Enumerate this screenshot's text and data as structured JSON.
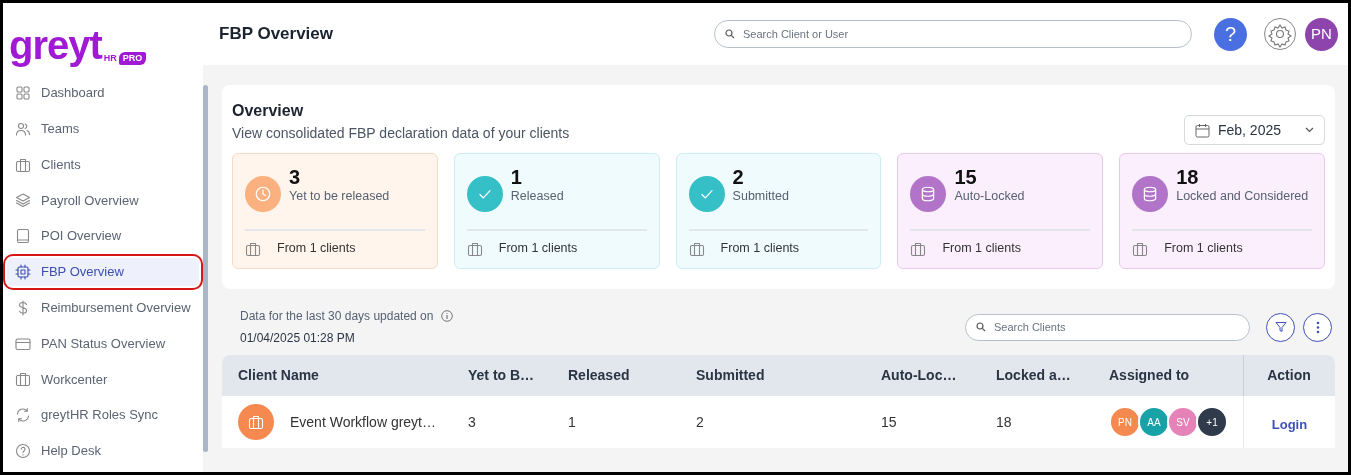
{
  "logo": {
    "word": "greyt",
    "sub": "HR",
    "badge": "PRO"
  },
  "sidebar": {
    "items": [
      {
        "label": "Dashboard",
        "kind": "grid",
        "selected": false,
        "highlighted": false
      },
      {
        "label": "Teams",
        "kind": "people",
        "selected": false,
        "highlighted": false
      },
      {
        "label": "Clients",
        "kind": "briefcase",
        "selected": false,
        "highlighted": false
      },
      {
        "label": "Payroll Overview",
        "kind": "layers",
        "selected": false,
        "highlighted": false
      },
      {
        "label": "POI Overview",
        "kind": "book",
        "selected": false,
        "highlighted": false
      },
      {
        "label": "FBP Overview",
        "kind": "chip",
        "selected": true,
        "highlighted": true
      },
      {
        "label": "Reimbursement Overview",
        "kind": "dollar",
        "selected": false,
        "highlighted": false
      },
      {
        "label": "PAN Status Overview",
        "kind": "card",
        "selected": false,
        "highlighted": false
      },
      {
        "label": "Workcenter",
        "kind": "briefcase",
        "selected": false,
        "highlighted": false
      },
      {
        "label": "greytHR Roles Sync",
        "kind": "sync",
        "selected": false,
        "highlighted": false
      },
      {
        "label": "Help Desk",
        "kind": "help",
        "selected": false,
        "highlighted": false
      }
    ]
  },
  "header": {
    "title": "FBP Overview",
    "search": {
      "placeholder": "Search Client or User"
    },
    "help": "?",
    "user_initials": "PN"
  },
  "overview": {
    "title": "Overview",
    "subtitle": "View consolidated FBP declaration data of your clients",
    "month": "Feb, 2025",
    "stats": [
      {
        "count": "3",
        "label": "Yet to be released",
        "footer": "From 1 clients",
        "kind": "pending"
      },
      {
        "count": "1",
        "label": "Released",
        "footer": "From 1 clients",
        "kind": "done"
      },
      {
        "count": "2",
        "label": "Submitted",
        "footer": "From 1 clients",
        "kind": "done"
      },
      {
        "count": "15",
        "label": "Auto-Locked",
        "footer": "From 1 clients",
        "kind": "locked"
      },
      {
        "count": "18",
        "label": "Locked and Considered",
        "footer": "From 1 clients",
        "kind": "locked"
      }
    ]
  },
  "data_note": {
    "text": "Data for the last 30 days updated on",
    "updated": "01/04/2025 01:28 PM"
  },
  "client_search": {
    "placeholder": "Search Clients"
  },
  "table": {
    "columns": [
      "Client Name",
      "Yet to B…",
      "Released",
      "Submitted",
      "Auto-Loc…",
      "Locked a…",
      "Assigned to",
      "Action"
    ],
    "rows": [
      {
        "client": "Event Workflow greyt…",
        "values": [
          "3",
          "1",
          "2",
          "15",
          "18"
        ],
        "assignees": [
          {
            "initials": "PN",
            "color": "#f5894f"
          },
          {
            "initials": "AA",
            "color": "#17a2a8"
          },
          {
            "initials": "SV",
            "color": "#e583b8"
          },
          {
            "initials": "+1",
            "color": "#2f3a4a"
          }
        ],
        "action": "Login"
      }
    ]
  }
}
